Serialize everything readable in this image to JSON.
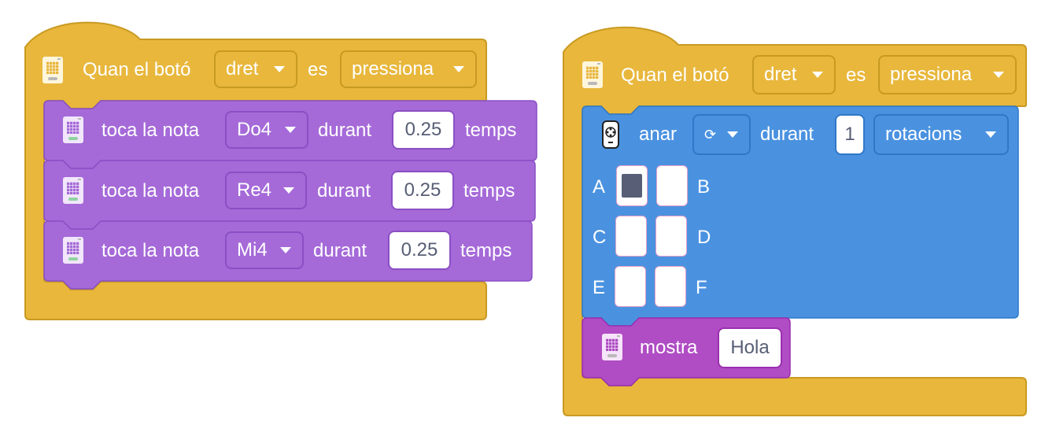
{
  "colors": {
    "event_yellow": "#e8b73c",
    "music_purple": "#a56ad8",
    "motor_blue": "#4a92e0",
    "display_magenta": "#b04cc4",
    "input_text": "#575e75"
  },
  "left_script": {
    "hat": {
      "label_when": "Quan el botó",
      "button_value": "dret",
      "label_is": "es",
      "action_value": "pressiona"
    },
    "notes": [
      {
        "label": "toca la nota",
        "note": "Do4",
        "during_label": "durant",
        "duration": "0.25",
        "unit": "temps"
      },
      {
        "label": "toca la nota",
        "note": "Re4",
        "during_label": "durant",
        "duration": "0.25",
        "unit": "temps"
      },
      {
        "label": "toca la nota",
        "note": "Mi4",
        "during_label": "durant",
        "duration": "0.25",
        "unit": "temps"
      }
    ]
  },
  "right_script": {
    "hat": {
      "label_when": "Quan el botó",
      "button_value": "dret",
      "label_is": "es",
      "action_value": "pressiona"
    },
    "motor": {
      "label_go": "anar",
      "direction_value": "⟳",
      "during_label": "durant",
      "amount": "1",
      "unit_value": "rotacions",
      "ports": [
        {
          "left": "A",
          "right": "B",
          "left_selected": true,
          "right_selected": false
        },
        {
          "left": "C",
          "right": "D",
          "left_selected": false,
          "right_selected": false
        },
        {
          "left": "E",
          "right": "F",
          "left_selected": false,
          "right_selected": false
        }
      ]
    },
    "display": {
      "label": "mostra",
      "text": "Hola"
    }
  },
  "icons": {
    "microbit": "microbit-icon",
    "motor": "motor-icon",
    "caret": "caret-down-icon"
  }
}
